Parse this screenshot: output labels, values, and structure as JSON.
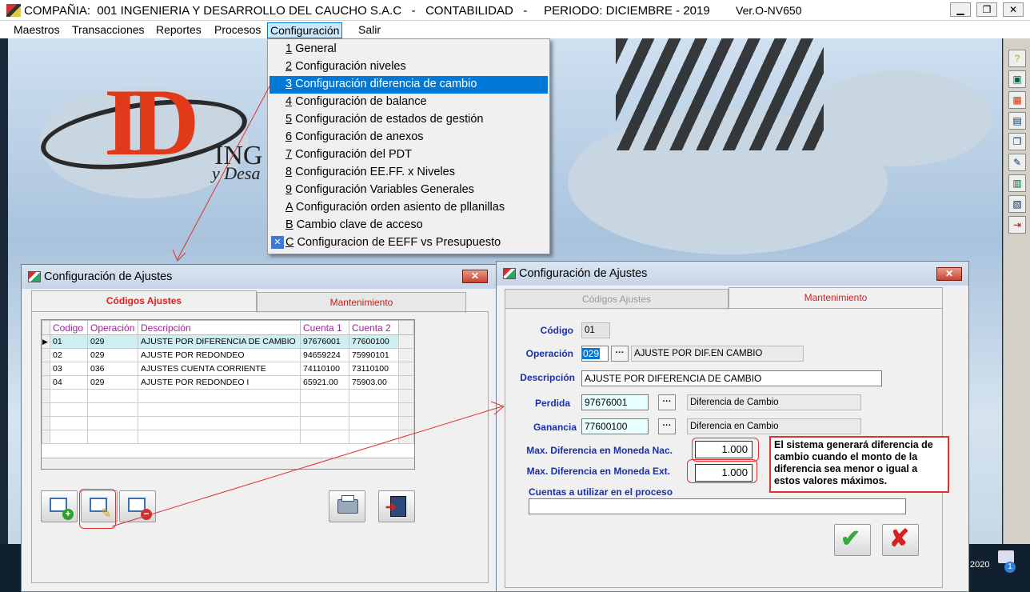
{
  "app": {
    "title": "COMPAÑIA:  001 INGENIERIA Y DESARROLLO DEL CAUCHO S.A.C   -   CONTABILIDAD   -     PERIODO: DICIEMBRE - 2019",
    "version": "Ver.O-NV650",
    "minimize": "▁",
    "restore": "❐",
    "close": "✕"
  },
  "menu": {
    "items": [
      "Maestros",
      "Transacciones",
      "Reportes",
      "Procesos",
      "Configuración",
      "Salir"
    ]
  },
  "dropdown": {
    "items": [
      {
        "key": "1",
        "label": " General"
      },
      {
        "key": "2",
        "label": " Configuración niveles"
      },
      {
        "key": "3",
        "label": " Configuración diferencia de cambio"
      },
      {
        "key": "4",
        "label": " Configuración de balance"
      },
      {
        "key": "5",
        "label": " Configuración de estados de gestión"
      },
      {
        "key": "6",
        "label": " Configuración de anexos"
      },
      {
        "key": "7",
        "label": " Configuración del PDT"
      },
      {
        "key": "8",
        "label": " Configuración EE.FF. x Niveles"
      },
      {
        "key": "9",
        "label": " Configuración Variables Generales"
      },
      {
        "key": "A",
        "label": " Configuración orden asiento de pllanillas"
      },
      {
        "key": "B",
        "label": " Cambio clave de acceso"
      },
      {
        "key": "C",
        "label": " Configuracion de EEFF vs Presupuesto"
      }
    ]
  },
  "logo": {
    "letters": "ID",
    "text1": "ING",
    "text2": "y Desa"
  },
  "win_left": {
    "title": "Configuración de Ajustes",
    "close": "✕",
    "tabs": [
      "Códigos Ajustes",
      "Mantenimiento"
    ],
    "columns": [
      "Codigo",
      "Operación",
      "Descripción",
      "Cuenta 1",
      "Cuenta 2"
    ],
    "rows": [
      [
        "01",
        "029",
        "AJUSTE POR DIFERENCIA DE CAMBIO",
        "97676001",
        "77600100"
      ],
      [
        "02",
        "029",
        "AJUSTE POR REDONDEO",
        "94659224",
        "75990101"
      ],
      [
        "03",
        "036",
        "AJUSTES CUENTA CORRIENTE",
        "74110100",
        "73110100"
      ],
      [
        "04",
        "029",
        "AJUSTE POR REDONDEO I",
        "65921.00",
        "75903.00"
      ]
    ],
    "row_marker": "▶"
  },
  "win_right": {
    "title": "Configuración de Ajustes",
    "close": "✕",
    "tabs": [
      "Códigos Ajustes",
      "Mantenimiento"
    ],
    "codigo_label": "Código",
    "codigo": "01",
    "operacion_label": "Operación",
    "operacion": "029",
    "operacion_desc": "AJUSTE POR DIF.EN CAMBIO",
    "descripcion_label": "Descripción",
    "descripcion": "AJUSTE POR DIFERENCIA DE CAMBIO",
    "perdida_label": "Perdida",
    "perdida": "97676001",
    "perdida_desc": "Diferencia de Cambio",
    "ganancia_label": "Ganancia",
    "ganancia": "77600100",
    "ganancia_desc": "Diferencia en Cambio",
    "maxnac_label": "Max. Diferencia en Moneda Nac.",
    "maxnac": "1.000",
    "maxext_label": "Max. Diferencia en Moneda Ext.",
    "maxext": "1.000",
    "cuentas_label": "Cuentas a utilizar en el proceso",
    "dots": "···"
  },
  "note": "El sistema generará diferencia de cambio cuando el monto de la diferencia sea menor o igual a estos valores máximos.",
  "taskbar": {
    "year": "2020",
    "badge": "1"
  },
  "colors": {
    "accent": "#0078d7",
    "annotation": "#e03030"
  }
}
